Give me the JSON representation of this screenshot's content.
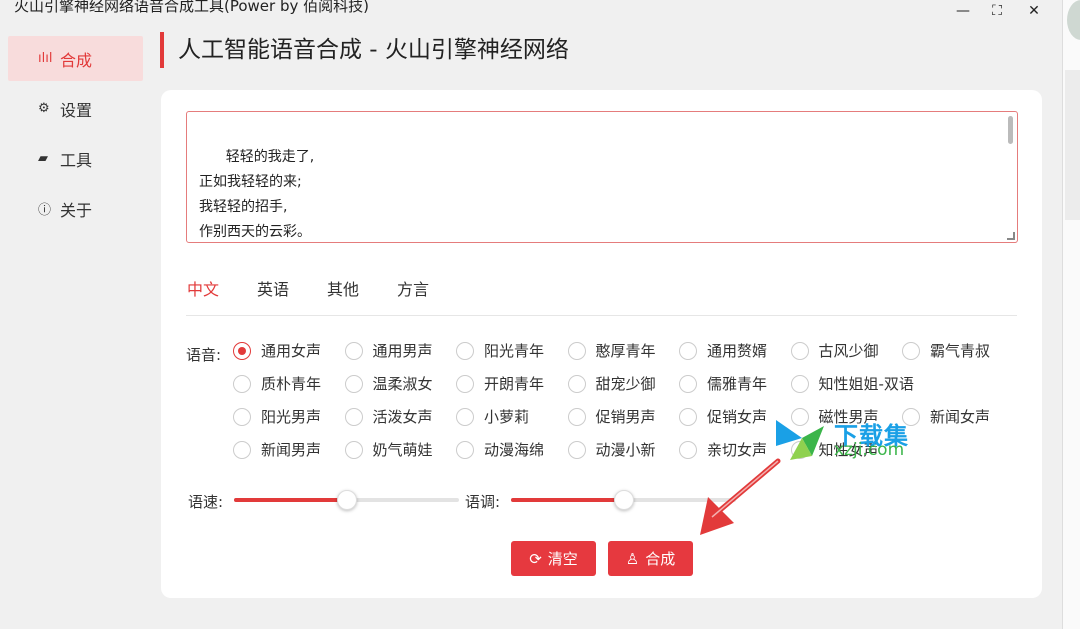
{
  "window": {
    "title": "火山引擎神经网络语音合成工具(Power by 佰阅科技)",
    "minimize": "—",
    "maximize": "⛶",
    "close": "✕"
  },
  "sidebar": {
    "items": [
      {
        "icon": "waveform-icon",
        "glyph": "ılıl",
        "label": "合成",
        "active": true
      },
      {
        "icon": "gear-icon",
        "glyph": "⚙",
        "label": "设置",
        "active": false
      },
      {
        "icon": "toolbox-icon",
        "glyph": "▰",
        "label": "工具",
        "active": false
      },
      {
        "icon": "info-icon",
        "glyph": "ⓘ",
        "label": "关于",
        "active": false
      }
    ]
  },
  "header": {
    "title": "人工智能语音合成 - 火山引擎神经网络"
  },
  "editor": {
    "text": "轻轻的我走了,\n正如我轻轻的来;\n我轻轻的招手,\n作别西天的云彩。\n\n那河畔的金柳,"
  },
  "tabs": [
    "中文",
    "英语",
    "其他",
    "方言"
  ],
  "active_tab": "中文",
  "voice": {
    "label": "语音:",
    "selected": "通用女声",
    "rows": [
      [
        "通用女声",
        "通用男声",
        "阳光青年",
        "憨厚青年",
        "通用赘婿",
        "古风少御",
        "霸气青叔"
      ],
      [
        "质朴青年",
        "温柔淑女",
        "开朗青年",
        "甜宠少御",
        "儒雅青年",
        "知性姐姐-双语"
      ],
      [
        "阳光男声",
        "活泼女声",
        "小萝莉",
        "促销男声",
        "促销女声",
        "磁性男声",
        "新闻女声"
      ],
      [
        "新闻男声",
        "奶气萌娃",
        "动漫海绵",
        "动漫小新",
        "亲切女声",
        "知性女声"
      ]
    ]
  },
  "speed": {
    "label": "语速:",
    "level": 0.5
  },
  "pitch": {
    "label": "语调:",
    "level": 0.5
  },
  "buttons": {
    "clear": {
      "icon": "refresh-icon",
      "glyph": "⟳",
      "label": "清空"
    },
    "synthesize": {
      "icon": "user-voice-icon",
      "glyph": "♙",
      "label": "合成"
    }
  },
  "watermark": {
    "line1": "下载集",
    "line2": "xzji.com"
  },
  "colors": {
    "accent": "#e23a3a",
    "button": "#e6393f"
  }
}
